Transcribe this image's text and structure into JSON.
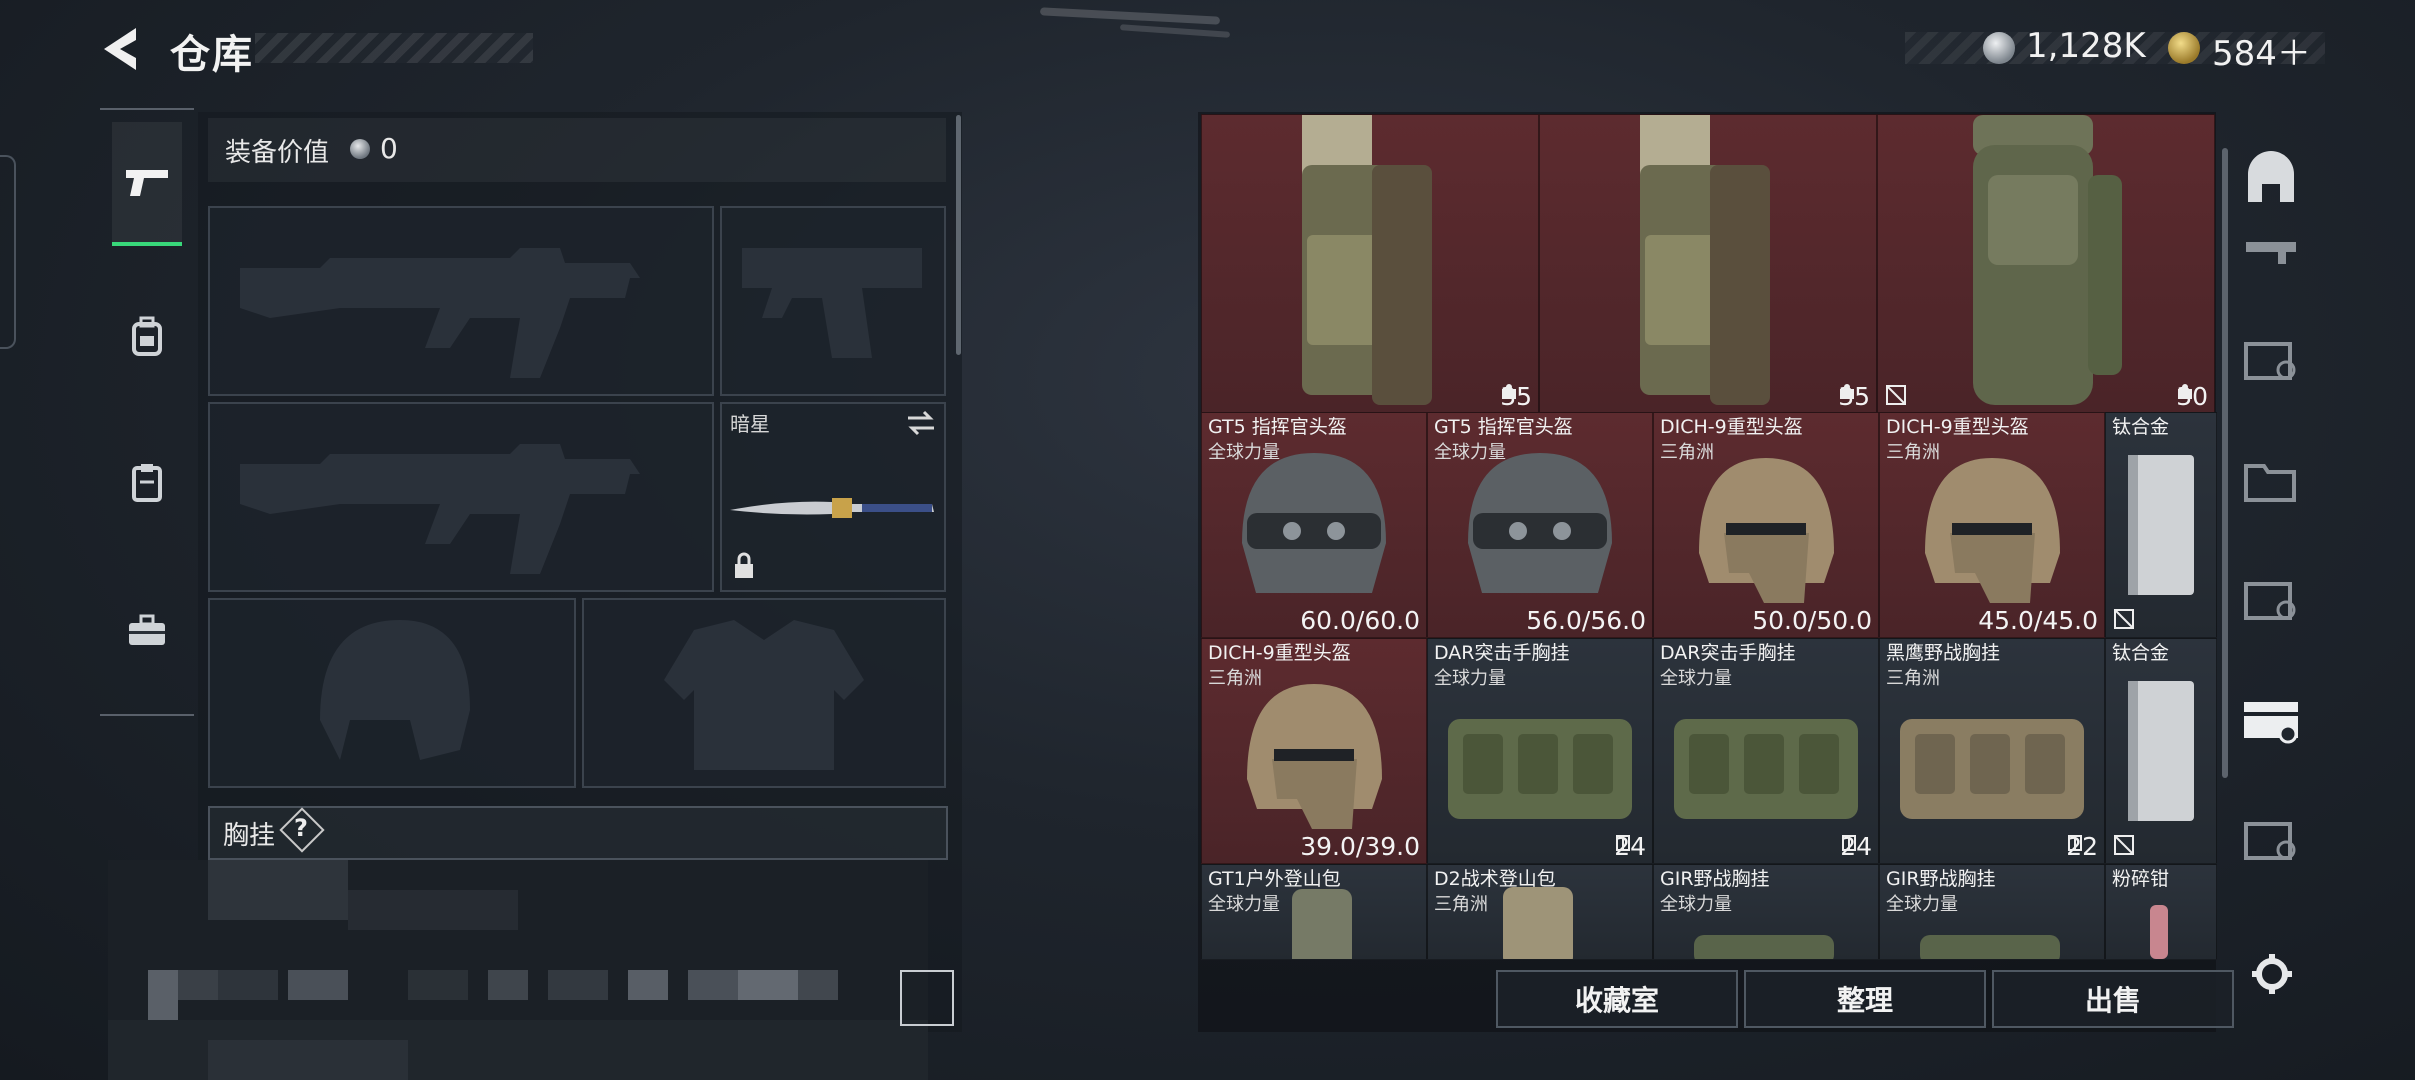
{
  "header": {
    "title": "仓库",
    "currency_silver": "1,128K",
    "currency_gold": "584＋"
  },
  "equipment": {
    "value_label": "装备价值",
    "value": "0",
    "knife_name": "暗星",
    "chest_label": "胸挂",
    "help": "?"
  },
  "inventory": {
    "top_row": [
      {
        "stat": "35",
        "icon": "weight-icon"
      },
      {
        "stat": "35",
        "icon": "weight-icon"
      },
      {
        "stat": "30",
        "icon": "weight-icon"
      }
    ],
    "rows": [
      [
        {
          "name": "GT5 指挥官头盔",
          "sub": "全球力量",
          "stat": "60.0/60.0",
          "type": "helmet-grey"
        },
        {
          "name": "GT5 指挥官头盔",
          "sub": "全球力量",
          "stat": "56.0/56.0",
          "type": "helmet-grey"
        },
        {
          "name": "DICH-9重型头盔",
          "sub": "三角洲",
          "stat": "50.0/50.0",
          "type": "helmet-tan"
        },
        {
          "name": "DICH-9重型头盔",
          "sub": "三角洲",
          "stat": "45.0/45.0",
          "type": "helmet-tan"
        },
        {
          "name": "钛合金",
          "sub": "",
          "stat": "",
          "type": "plate"
        }
      ],
      [
        {
          "name": "DICH-9重型头盔",
          "sub": "三角洲",
          "stat": "39.0/39.0",
          "type": "helmet-tan"
        },
        {
          "name": "DAR突击手胸挂",
          "sub": "全球力量",
          "stat": "24",
          "type": "rig-green"
        },
        {
          "name": "DAR突击手胸挂",
          "sub": "全球力量",
          "stat": "24",
          "type": "rig-green"
        },
        {
          "name": "黑鹰野战胸挂",
          "sub": "三角洲",
          "stat": "22",
          "type": "rig-tan"
        },
        {
          "name": "钛合金",
          "sub": "",
          "stat": "",
          "type": "plate"
        }
      ],
      [
        {
          "name": "GT1户外登山包",
          "sub": "全球力量",
          "stat": "",
          "type": "bag"
        },
        {
          "name": "D2战术登山包",
          "sub": "三角洲",
          "stat": "",
          "type": "bag"
        },
        {
          "name": "GIR野战胸挂",
          "sub": "全球力量",
          "stat": "",
          "type": "rig-green"
        },
        {
          "name": "GIR野战胸挂",
          "sub": "全球力量",
          "stat": "",
          "type": "rig-green"
        },
        {
          "name": "粉碎钳",
          "sub": "",
          "stat": "",
          "type": "tool"
        }
      ]
    ]
  },
  "buttons": {
    "collection": "收藏室",
    "organize": "整理",
    "sell": "出售"
  },
  "colors": {
    "accent_green": "#38d87a",
    "cell_red": "#5d2b2f",
    "cell_dark": "#2c333c"
  }
}
